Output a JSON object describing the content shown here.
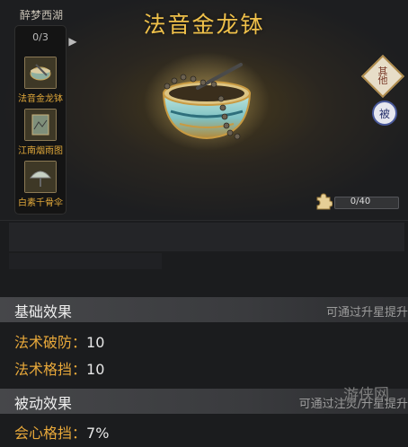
{
  "collection": {
    "name": "醉梦西湖",
    "progress": "0/3"
  },
  "side_items": [
    {
      "label": "法音金龙钵"
    },
    {
      "label": "江南烟雨图"
    },
    {
      "label": "白素千骨伞"
    }
  ],
  "item": {
    "title": "法音金龙钵"
  },
  "buttons": {
    "other": "其\n他",
    "passive": "被"
  },
  "shards": {
    "progress_text": "0/40",
    "current": 0,
    "total": 40
  },
  "base_section": {
    "title": "基础效果",
    "hint": "可通过升星提升",
    "stats": [
      {
        "name": "法术破防：",
        "value": "10"
      },
      {
        "name": "法术格挡：",
        "value": "10"
      }
    ]
  },
  "passive_section": {
    "title": "被动效果",
    "hint": "可通过注灵/升星提升",
    "stats": [
      {
        "name": "会心格挡：",
        "value": "7%"
      }
    ]
  },
  "watermark": "游侠网",
  "colors": {
    "gold": "#f0c14a",
    "stat_label": "#e9a93a"
  }
}
